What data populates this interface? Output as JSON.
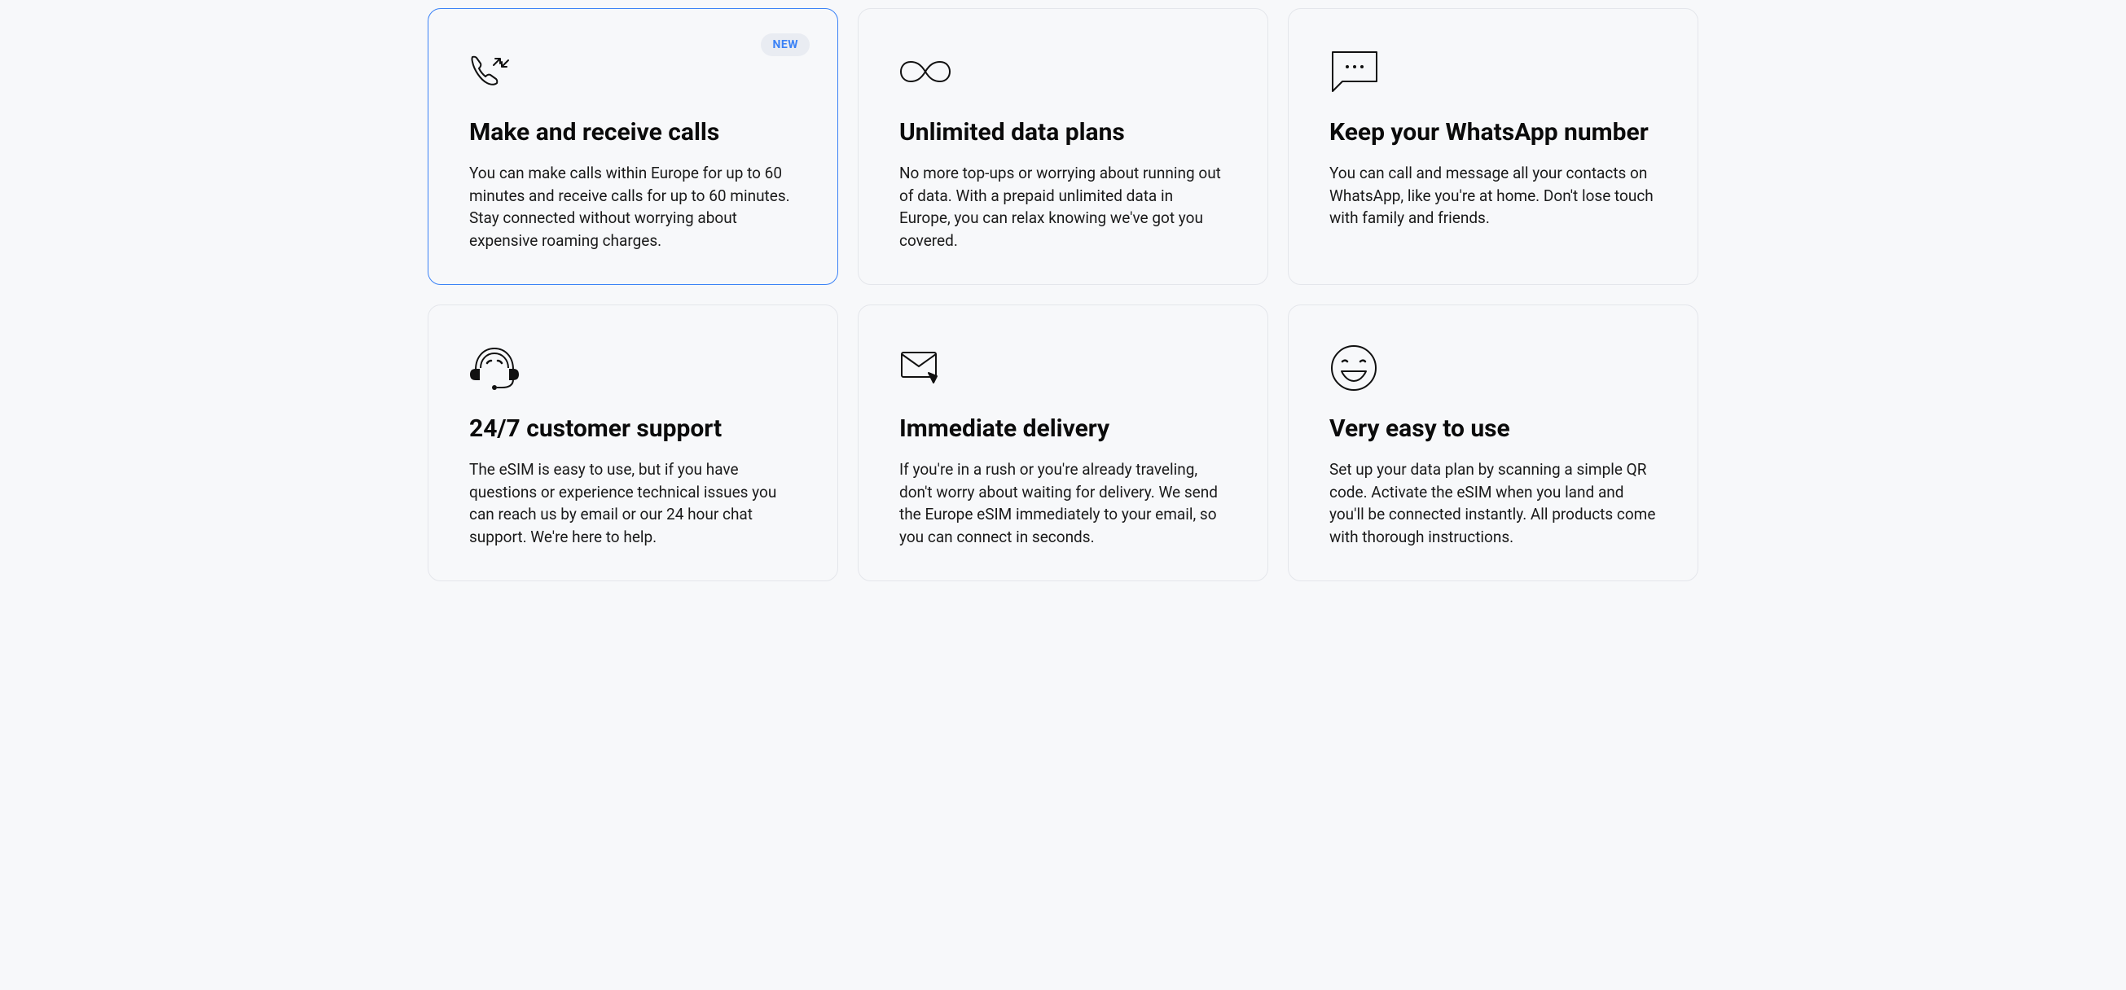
{
  "cards": [
    {
      "badge": "NEW",
      "title": "Make and receive calls",
      "description": "You can make calls within Europe for up to 60 minutes and receive calls for up to 60 minutes. Stay connected without worrying about expensive roaming charges."
    },
    {
      "title": "Unlimited data plans",
      "description": "No more top-ups or worrying about running out of data. With a prepaid unlimited data in Europe, you can relax knowing we've got you covered."
    },
    {
      "title": "Keep your WhatsApp number",
      "description": "You can call and message all your contacts on WhatsApp, like you're at home. Don't lose touch with family and friends."
    },
    {
      "title": "24/7 customer support",
      "description": "The eSIM is easy to use, but if you have questions or experience technical issues you can reach us by email or our 24 hour chat support. We're here to help."
    },
    {
      "title": "Immediate delivery",
      "description": "If you're in a rush or you're already traveling, don't worry about waiting for delivery. We send the Europe eSIM immediately to your email, so you can connect in seconds."
    },
    {
      "title": "Very easy to use",
      "description": "Set up your data plan by scanning a simple QR code. Activate the eSIM when you land and you'll be connected instantly. All products come with thorough instructions."
    }
  ]
}
